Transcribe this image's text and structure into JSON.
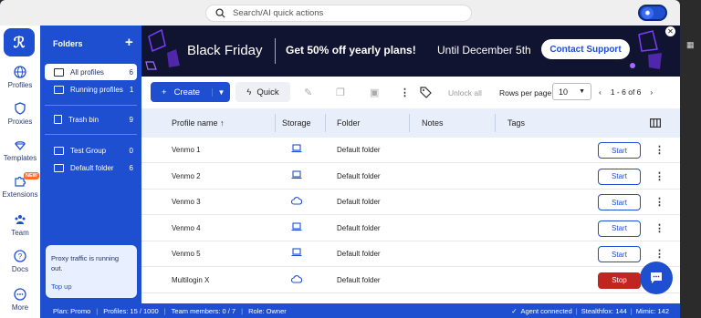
{
  "search": {
    "placeholder": "Search/AI quick actions"
  },
  "rail": {
    "logo": "ℛ",
    "items": [
      {
        "label": "Profiles",
        "icon": "globe-icon"
      },
      {
        "label": "Proxies",
        "icon": "shield-icon"
      },
      {
        "label": "Templates",
        "icon": "templates-icon"
      },
      {
        "label": "Extensions",
        "icon": "puzzle-icon"
      },
      {
        "label": "Team",
        "icon": "team-icon"
      },
      {
        "label": "Docs",
        "icon": "help-icon"
      },
      {
        "label": "More",
        "icon": "more-icon"
      }
    ],
    "new_badge": "NEW"
  },
  "folders": {
    "title": "Folders",
    "items": [
      {
        "label": "All profiles",
        "count": "6"
      },
      {
        "label": "Running profiles",
        "count": "1"
      },
      {
        "label": "Trash bin",
        "count": "9"
      },
      {
        "label": "Test Group",
        "count": "0"
      },
      {
        "label": "Default folder",
        "count": "6"
      }
    ],
    "proxy_notice": "Proxy traffic is running out.",
    "proxy_link": "Top up"
  },
  "banner": {
    "headline": "Black Friday",
    "offer": "Get 50% off yearly plans!",
    "until": "Until December 5th",
    "cta": "Contact Support"
  },
  "toolbar": {
    "create": "Create",
    "quick": "Quick",
    "unlock_all": "Unlock all",
    "rows_per_page_label": "Rows per page",
    "rows_per_page": "10",
    "range": "1 - 6 of 6"
  },
  "table": {
    "columns": [
      "Profile name ↑",
      "Storage",
      "Folder",
      "Notes",
      "Tags"
    ],
    "rows": [
      {
        "name": "Venmo 1",
        "storage": "local",
        "folder": "Default folder",
        "action": "Start"
      },
      {
        "name": "Venmo 2",
        "storage": "local",
        "folder": "Default folder",
        "action": "Start"
      },
      {
        "name": "Venmo 3",
        "storage": "cloud",
        "folder": "Default folder",
        "action": "Start"
      },
      {
        "name": "Venmo 4",
        "storage": "local",
        "folder": "Default folder",
        "action": "Start"
      },
      {
        "name": "Venmo 5",
        "storage": "local",
        "folder": "Default folder",
        "action": "Start"
      },
      {
        "name": "Multilogin X",
        "storage": "cloud",
        "folder": "Default folder",
        "action": "Stop"
      }
    ]
  },
  "status": {
    "plan": "Plan: Promo",
    "profiles": "Profiles: 15 / 1000",
    "team": "Team members: 0 / 7",
    "role": "Role: Owner",
    "agent": "Agent connected",
    "stealthfox": "Stealthfox: 144",
    "mimic": "Mimic: 142"
  },
  "colors": {
    "primary": "#1f4fd1",
    "stop": "#c0261f",
    "banner": "#111430"
  }
}
